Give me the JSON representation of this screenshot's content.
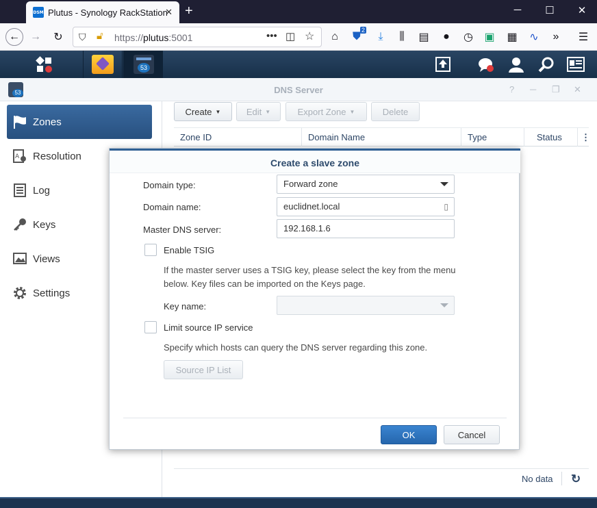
{
  "browser": {
    "tab_title": "Plutus - Synology RackStation",
    "favicon_text": "DSM",
    "url_prefix": "https://",
    "url_host": "plutus",
    "url_port": ":5001",
    "badge_count": "2"
  },
  "taskbar": {
    "calendar_day": "53"
  },
  "window": {
    "title": "DNS Server",
    "app_icon_day": "53"
  },
  "sidebar": {
    "items": [
      {
        "label": "Zones",
        "icon": "flag-icon",
        "active": true
      },
      {
        "label": "Resolution",
        "icon": "resolution-icon"
      },
      {
        "label": "Log",
        "icon": "log-icon"
      },
      {
        "label": "Keys",
        "icon": "key-icon"
      },
      {
        "label": "Views",
        "icon": "views-icon"
      },
      {
        "label": "Settings",
        "icon": "gear-icon"
      }
    ]
  },
  "toolbar": {
    "create": "Create",
    "edit": "Edit",
    "export_zone": "Export Zone",
    "delete": "Delete"
  },
  "grid": {
    "columns": [
      "Zone ID",
      "Domain Name",
      "Type",
      "Status"
    ],
    "empty_text": "No data"
  },
  "dialog": {
    "title": "Create a slave zone",
    "domain_type_label": "Domain type:",
    "domain_type_value": "Forward zone",
    "domain_name_label": "Domain name:",
    "domain_name_value": "euclidnet.local",
    "master_dns_label": "Master DNS server:",
    "master_dns_value": "192.168.1.6",
    "enable_tsig_label": "Enable TSIG",
    "tsig_desc_1": "If the master server uses a TSIG key, please select the key from the menu",
    "tsig_desc_2": "below. Key files can be imported on the Keys page.",
    "key_name_label": "Key name:",
    "key_name_value": "",
    "limit_source_label": "Limit source IP service",
    "limit_desc": "Specify which hosts can query the DNS server regarding this zone.",
    "source_ip_button": "Source IP List",
    "ok": "OK",
    "cancel": "Cancel"
  },
  "colors": {
    "accent": "#2e5a8c",
    "ok_button": "#2f73c0",
    "taskbar": "#1d3148"
  }
}
